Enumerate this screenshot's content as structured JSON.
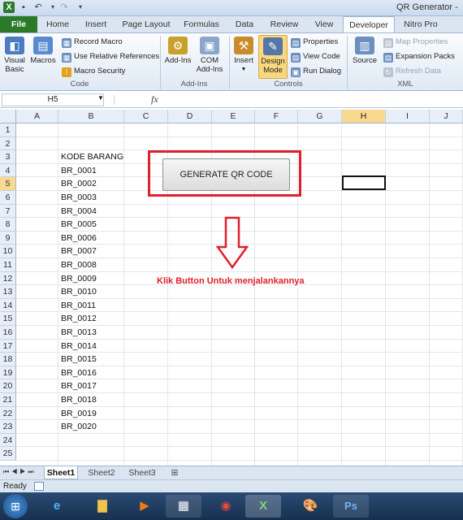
{
  "window": {
    "title": "QR Generator -"
  },
  "tabs": [
    {
      "label": "Home"
    },
    {
      "label": "Insert"
    },
    {
      "label": "Page Layout"
    },
    {
      "label": "Formulas"
    },
    {
      "label": "Data"
    },
    {
      "label": "Review"
    },
    {
      "label": "View"
    },
    {
      "label": "Developer"
    },
    {
      "label": "Nitro Pro"
    }
  ],
  "file_tab": "File",
  "ribbon": {
    "code": {
      "visual_basic": "Visual Basic",
      "macros": "Macros",
      "record_macro": "Record Macro",
      "relative_refs": "Use Relative References",
      "macro_security": "Macro Security",
      "label": "Code"
    },
    "addins": {
      "addins": "Add-Ins",
      "com_addins": "COM Add-Ins",
      "label": "Add-Ins"
    },
    "controls": {
      "insert": "Insert",
      "design_mode": "Design Mode",
      "properties": "Properties",
      "view_code": "View Code",
      "run_dialog": "Run Dialog",
      "label": "Controls"
    },
    "xml": {
      "source": "Source",
      "map_properties": "Map Properties",
      "expansion_packs": "Expansion Packs",
      "refresh_data": "Refresh Data",
      "label": "XML"
    }
  },
  "formula_bar": {
    "name_box": "H5",
    "fx": "fx",
    "value": ""
  },
  "columns": [
    "A",
    "B",
    "C",
    "D",
    "E",
    "F",
    "G",
    "H",
    "I",
    "J"
  ],
  "selected_column": "H",
  "rows": [
    "1",
    "2",
    "3",
    "4",
    "5",
    "6",
    "7",
    "8",
    "9",
    "10",
    "11",
    "12",
    "13",
    "14",
    "15",
    "16",
    "17",
    "18",
    "19",
    "20",
    "21",
    "22",
    "23",
    "24",
    "25"
  ],
  "selected_row": "5",
  "column_b": {
    "header": "KODE BARANG",
    "values": [
      "BR_0001",
      "BR_0002",
      "BR_0003",
      "BR_0004",
      "BR_0005",
      "BR_0006",
      "BR_0007",
      "BR_0008",
      "BR_0009",
      "BR_0010",
      "BR_0011",
      "BR_0012",
      "BR_0013",
      "BR_0014",
      "BR_0015",
      "BR_0016",
      "BR_0017",
      "BR_0018",
      "BR_0019",
      "BR_0020"
    ]
  },
  "button": {
    "label": "GENERATE QR CODE"
  },
  "annotation": {
    "text": "Klik Button Untuk menjalankannya",
    "color": "#e0202a"
  },
  "sheets": [
    "Sheet1",
    "Sheet2",
    "Sheet3"
  ],
  "active_sheet": "Sheet1",
  "status": "Ready",
  "colors": {
    "file_tab": "#2a7a2a",
    "highlight": "#f9d98f",
    "accent_red": "#e0202a"
  }
}
